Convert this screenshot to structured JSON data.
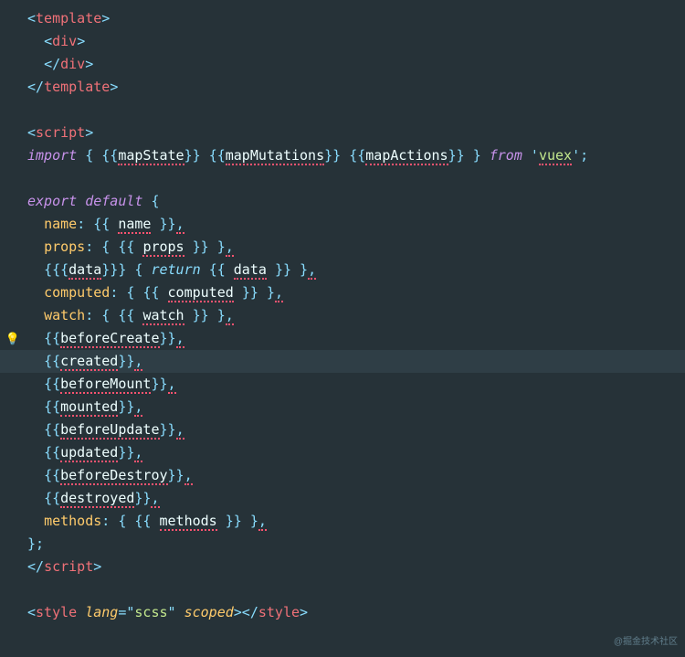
{
  "tags": {
    "template": "template",
    "div": "div",
    "script": "script",
    "style": "style"
  },
  "keywords": {
    "import": "import",
    "export": "export",
    "default": "default",
    "from": "from",
    "return": "return"
  },
  "imports": {
    "mapState": "mapState",
    "mapMutations": "mapMutations",
    "mapActions": "mapActions",
    "module": "vuex"
  },
  "props": {
    "name": "name",
    "props": "props",
    "data_key": "data",
    "data_val": "data",
    "computed": "computed",
    "watch": "watch",
    "methods": "methods"
  },
  "placeholders": {
    "name": "name",
    "props": "props",
    "data": "data",
    "computed": "computed",
    "watch": "watch",
    "methods": "methods"
  },
  "hooks": {
    "beforeCreate": "beforeCreate",
    "created": "created",
    "beforeMount": "beforeMount",
    "mounted": "mounted",
    "beforeUpdate": "beforeUpdate",
    "updated": "updated",
    "beforeDestroy": "beforeDestroy",
    "destroyed": "destroyed"
  },
  "styleAttrs": {
    "langName": "lang",
    "langVal": "scss",
    "scoped": "scoped"
  },
  "icons": {
    "bulb": "💡"
  },
  "watermark": "@掘金技术社区"
}
